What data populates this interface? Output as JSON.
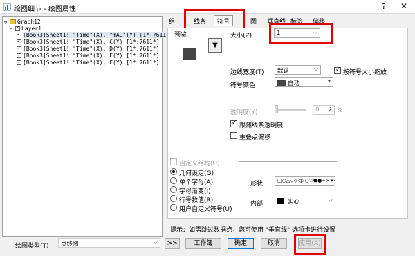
{
  "window": {
    "title": "绘图细节 - 绘图属性",
    "help": "?",
    "close": "✕"
  },
  "tree": {
    "items": [
      {
        "label": "Graph12",
        "expand": "⊖",
        "checked": null
      },
      {
        "label": "Layer1",
        "expand": "⊖",
        "checked": true
      },
      {
        "label": "[Book3]Sheet1! \"Time\"(X), \"mAU\"(Y) [1*:7611*]",
        "checked": true
      },
      {
        "label": "[Book3]Sheet1! \"Time\"(X), C(Y) [1*:7611*]",
        "checked": true
      },
      {
        "label": "[Book3]Sheet1! \"Time\"(X), D(Y) [1*:7611*]",
        "checked": true
      },
      {
        "label": "[Book3]Sheet1! \"Time\"(X), E(Y) [1*:7611*]",
        "checked": true
      },
      {
        "label": "[Book3]Sheet1! \"Time\"(X), F(Y) [1*:7611*]",
        "checked": true
      }
    ]
  },
  "tabs": [
    "组",
    "线条",
    "符号",
    "图",
    "垂直线",
    "标签",
    "偏移"
  ],
  "active_tab": "符号",
  "symbol": {
    "preview_label": "预览",
    "size_label": "大小(Z)",
    "size_value": "1",
    "edge_label": "边线宽度(T)",
    "edge_value": "默认",
    "scale_label": "按符号大小缩放",
    "color_label": "符号颜色",
    "color_value": "自动",
    "transparency_label": "透明度(Y)",
    "transparency_value": "0",
    "transparency_unit": "%",
    "follow_line_label": "跟随线条透明度",
    "overlap_label": "重叠点偏移",
    "custom_struct_label": "自定义结构(U)",
    "radio_geometry": "几何设定(G)",
    "radio_single_char": "单个字母(A)",
    "radio_char_gradient": "字母渐变(I)",
    "radio_row_number": "行号数值(R)",
    "radio_user_defined": "用户自定义符号(U)",
    "shape_label": "形状",
    "shape_value": "□○△▽◇◁▷○☆⬟●+×✶-",
    "interior_label": "内部",
    "interior_value": "实心",
    "hint": "提示：如需跳过数据点，您可使用 \"垂直线\" 选项卡进行设置"
  },
  "bottom": {
    "plot_type_label": "绘图类型(T)",
    "plot_type_value": "点线图",
    "more_btn": ">>",
    "workbook_btn": "工作簿",
    "ok_btn": "确定",
    "cancel_btn": "取消",
    "apply_btn": "应用(A)"
  },
  "colors": {
    "highlight": "#e00000",
    "symbol_color": "#444444"
  }
}
